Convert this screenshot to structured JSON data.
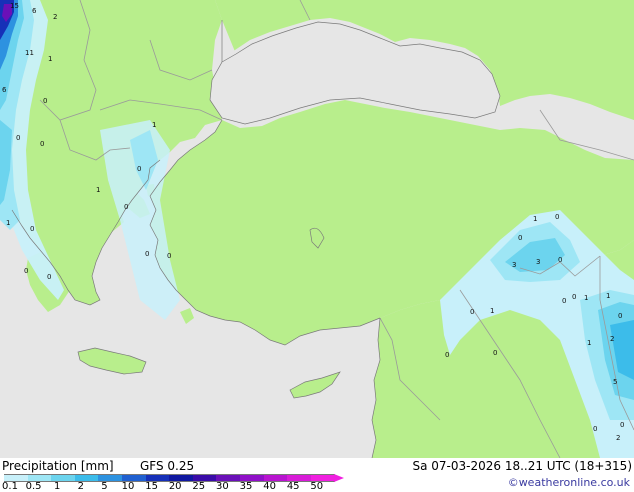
{
  "map": {
    "colors": {
      "sea": "#e6e6e6",
      "land": "#b8ee8c",
      "border": "#9a9a9a",
      "coast": "#7a7a7a"
    },
    "point_values": [
      "15",
      "6",
      "2",
      "11",
      "1",
      "6",
      "0",
      "1",
      "0",
      "0",
      "0",
      "1",
      "0",
      "0",
      "0",
      "0",
      "0",
      "0",
      "0",
      "0",
      "0",
      "1",
      "0",
      "3",
      "3",
      "0",
      "0",
      "1",
      "1",
      "0",
      "1",
      "1",
      "2",
      "0",
      "5",
      "0",
      "0",
      "2",
      "0",
      "1"
    ]
  },
  "footer": {
    "title": "Precipitation [mm]",
    "model": "GFS 0.25",
    "valid_time": "Sa 07-03-2026 18..21 UTC (18+315)",
    "credit": "©weatheronline.co.uk",
    "colorbar": {
      "ticks": [
        "0.1",
        "0.5",
        "1",
        "2",
        "5",
        "10",
        "15",
        "20",
        "25",
        "30",
        "35",
        "40",
        "45",
        "50"
      ],
      "colors": [
        "#c8f0fa",
        "#9ee6f5",
        "#6cd4ee",
        "#3cbcea",
        "#2d92e0",
        "#2060d0",
        "#1630b8",
        "#1018a0",
        "#3a0ca8",
        "#6a10b8",
        "#9010c8",
        "#b814d0",
        "#d81cd8",
        "#f020e0"
      ]
    }
  }
}
